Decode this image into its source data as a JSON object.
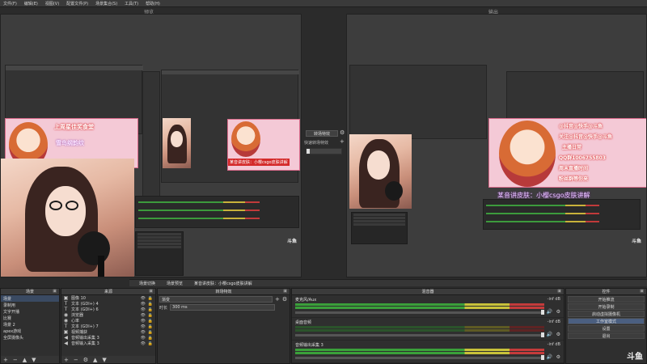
{
  "menu": [
    "文件(F)",
    "编辑(E)",
    "视图(V)",
    "配置文件(P)",
    "场景集合(S)",
    "工具(T)",
    "帮助(H)"
  ],
  "preview_label": "预览",
  "program_label": "输出",
  "overlay": {
    "title_banner": "上周星佳奖食堂",
    "subtitle": "雪鸟纲韵纹",
    "red_banner": "某音讲皮肤：小樱csgo皮肤讲解",
    "purple_banner": "某音讲皮肤：小樱csgo皮肤讲解",
    "right_lines": [
      "@抖音@快手@斗鱼",
      "关注@抖音@快手@斗鱼",
      "主播日常",
      "QQ群1006755803",
      "周末直播时间",
      "粉丝群等你来"
    ]
  },
  "watermark": "斗鱼",
  "transition_mid": {
    "btn_label": "转场特效",
    "quick_label": "快速转场特效",
    "add_icon": "+",
    "gear_icon": "⚙"
  },
  "tabs": [
    "场景切换",
    "场景预览",
    "某音讲皮肤：小樱csgo皮肤讲解"
  ],
  "scenes": {
    "title": "场景",
    "items": [
      "场景",
      "录制用",
      "文字开播",
      "比赛",
      "场景 2",
      "apex游戏",
      "全屏摄像头"
    ],
    "selected": 0
  },
  "sources": {
    "title": "来源",
    "items": [
      {
        "icon": "▣",
        "label": "图像 10"
      },
      {
        "icon": "T",
        "label": "文本 (GDI+) 4"
      },
      {
        "icon": "T",
        "label": "文本 (GDI+) 6"
      },
      {
        "icon": "◉",
        "label": "浏览器"
      },
      {
        "icon": "◉",
        "label": "心率"
      },
      {
        "icon": "T",
        "label": "文本 (GDI+) 7"
      },
      {
        "icon": "▣",
        "label": "视频捕获"
      },
      {
        "icon": "◀",
        "label": "音频输出采集 3"
      },
      {
        "icon": "◀",
        "label": "音频输入采集 3"
      }
    ]
  },
  "transitions": {
    "title": "转场特效",
    "current": "渐变",
    "duration_label": "时长",
    "duration_value": "300 ms"
  },
  "mixer": {
    "title": "混音器",
    "channels": [
      {
        "name": "麦克风/Aux",
        "db": "-inf dB",
        "active": true
      },
      {
        "name": "桌面音频",
        "db": "-inf dB",
        "active": false
      },
      {
        "name": "音频输出采集 3",
        "db": "-inf dB",
        "active": true
      }
    ]
  },
  "controls": {
    "title": "控件",
    "buttons": [
      "开始推流",
      "开始录制",
      "启动虚拟摄像机",
      "工作室模式",
      "设置",
      "退出"
    ],
    "active_index": 3
  }
}
